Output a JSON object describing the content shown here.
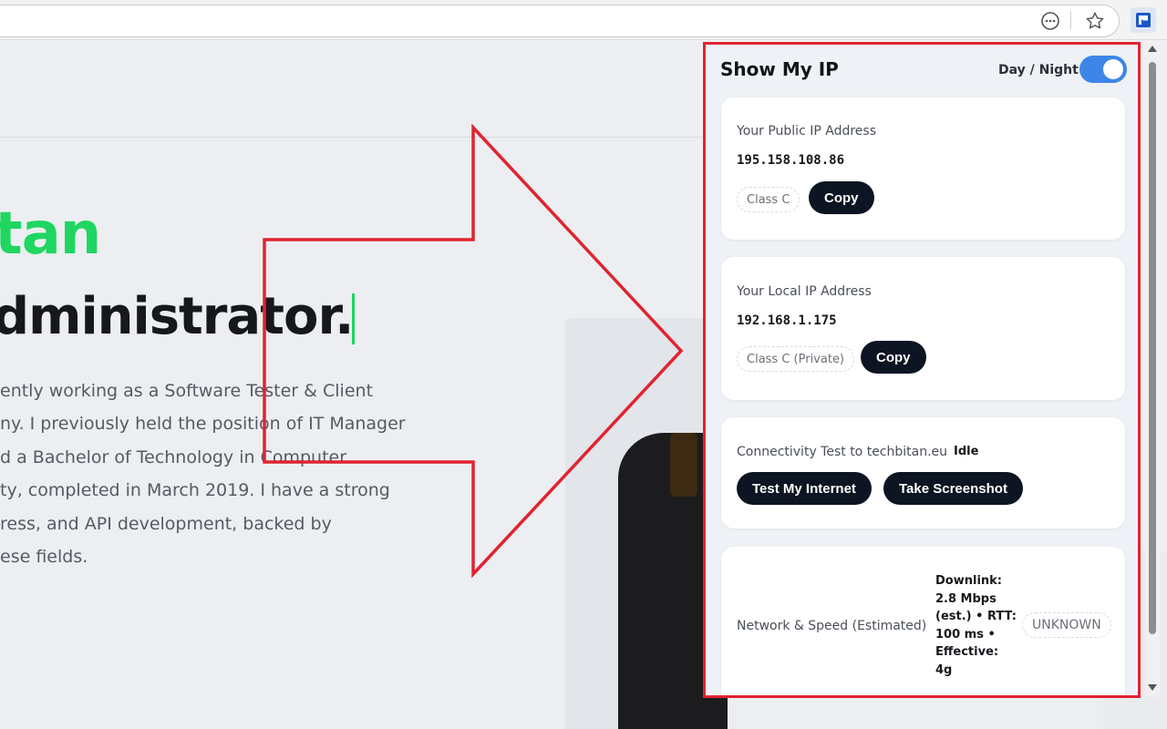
{
  "colors": {
    "accent_green": "#1fd660",
    "annotation_red": "#e02430",
    "button_dark": "#0d1422",
    "toggle_blue": "#3d86e8"
  },
  "browser": {
    "icons": [
      "more-icon",
      "star-icon",
      "extension-icon"
    ]
  },
  "hero": {
    "name": "tan",
    "role": "dministrator.",
    "bio_lines": [
      "ently working as a Software Tester & Client",
      "ny. I previously held the position of IT Manager",
      "d a Bachelor of Technology in Computer",
      "ty, completed in March 2019. I have a strong",
      "ress, and API development, backed by",
      "ese fields."
    ]
  },
  "popup": {
    "title": "Show My IP",
    "daynight_label": "Day / Night",
    "daynight_on": true,
    "public_ip": {
      "label": "Your Public IP Address",
      "value": "195.158.108.86",
      "class": "Class C",
      "copy": "Copy"
    },
    "local_ip": {
      "label": "Your Local IP Address",
      "value": "192.168.1.175",
      "class": "Class C (Private)",
      "copy": "Copy"
    },
    "connectivity": {
      "label": "Connectivity Test to techbitan.eu",
      "status": "Idle",
      "test_button": "Test My Internet",
      "screenshot_button": "Take Screenshot"
    },
    "network": {
      "label": "Network & Speed (Estimated)",
      "details_lines": [
        "Downlink:",
        "2.8 Mbps",
        "(est.) • RTT:",
        "100 ms •",
        "Effective:",
        "4g"
      ],
      "badge": "UNKNOWN"
    }
  }
}
